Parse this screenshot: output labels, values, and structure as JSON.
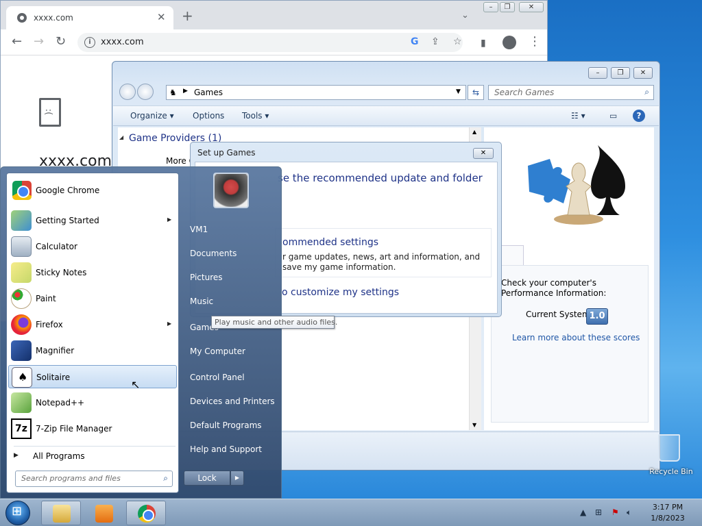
{
  "chrome": {
    "tab_title": "xxxx.com",
    "url": "xxxx.com",
    "heading": "xxxx.com i"
  },
  "explorer": {
    "address": "Games",
    "search_placeholder": "Search Games",
    "commands": [
      "Organize",
      "Options",
      "Tools"
    ],
    "group_header": "Game Providers (1)",
    "more_label": "More G",
    "perf_text": "Check your computer's Performance Information:",
    "current_system": "Current System",
    "score": "1.0",
    "learn_more": "Learn more about these scores"
  },
  "setup_dialog": {
    "title": "Set up Games",
    "question": "se the recommended update and folder",
    "option1_title": "ommended settings",
    "option1_desc": "r game updates, news, art and information, and save my game information.",
    "option2": "o customize my settings"
  },
  "tooltip": "Play music and other audio files.",
  "start_menu": {
    "programs": [
      {
        "label": "Google Chrome",
        "arrow": false,
        "icon": "chrome-icon"
      },
      {
        "label": "Getting Started",
        "arrow": true,
        "icon": "getting-started-icon"
      },
      {
        "label": "Calculator",
        "arrow": false,
        "icon": "calculator-icon"
      },
      {
        "label": "Sticky Notes",
        "arrow": false,
        "icon": "sticky-notes-icon"
      },
      {
        "label": "Paint",
        "arrow": false,
        "icon": "paint-icon"
      },
      {
        "label": "Firefox",
        "arrow": true,
        "icon": "firefox-icon"
      },
      {
        "label": "Magnifier",
        "arrow": false,
        "icon": "magnifier-icon"
      },
      {
        "label": "Solitaire",
        "arrow": false,
        "icon": "solitaire-icon",
        "selected": true
      },
      {
        "label": "Notepad++",
        "arrow": false,
        "icon": "notepad-plus-plus-icon"
      },
      {
        "label": "7-Zip File Manager",
        "arrow": false,
        "icon": "seven-zip-icon"
      }
    ],
    "all_programs": "All Programs",
    "search_placeholder": "Search programs and files",
    "right_items": [
      "VM1",
      "Documents",
      "Pictures",
      "Music",
      "Games",
      "My Computer",
      "Control Panel",
      "Devices and Printers",
      "Default Programs",
      "Help and Support"
    ],
    "lock": "Lock"
  },
  "desktop": {
    "recycle_bin": "Recycle Bin"
  },
  "taskbar": {
    "time": "3:17 PM",
    "date": "1/8/2023"
  }
}
